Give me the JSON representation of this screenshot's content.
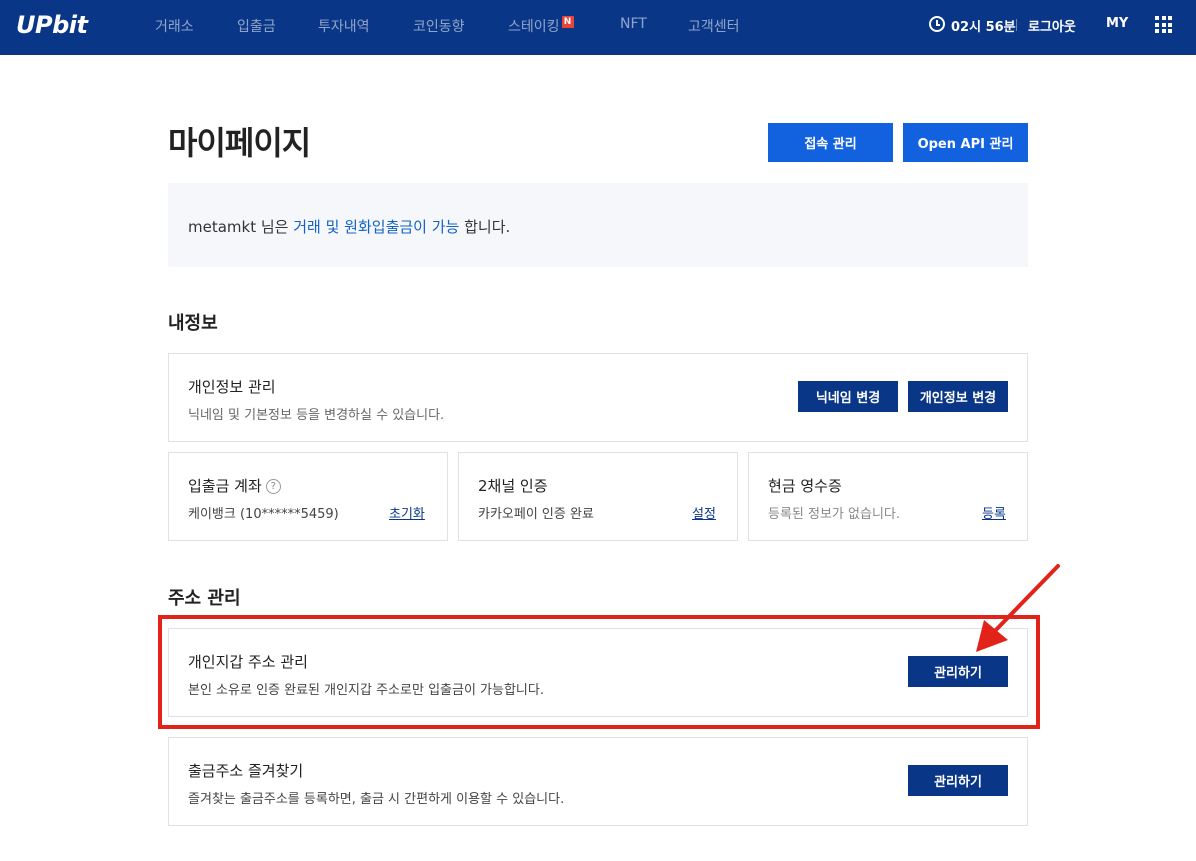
{
  "header": {
    "logo": "UPbit",
    "nav": [
      "거래소",
      "입출금",
      "투자내역",
      "코인동향",
      "스테이킹",
      "NFT",
      "고객센터"
    ],
    "new_badge": "N",
    "time": "02시 56분",
    "logout": "로그아웃",
    "my": "MY"
  },
  "page": {
    "title": "마이페이지",
    "access_btn": "접속 관리",
    "api_btn": "Open API 관리"
  },
  "notice": {
    "user": "metamkt 님은 ",
    "highlight": "거래 및 원화입출금이 가능",
    "suffix": " 합니다."
  },
  "my_info": {
    "title": "내정보",
    "personal": {
      "title": "개인정보 관리",
      "sub": "닉네임 및 기본정보 등을 변경하실 수 있습니다.",
      "nickname_btn": "닉네임 변경",
      "info_btn": "개인정보 변경"
    },
    "account": {
      "title": "입출금 계좌",
      "help": "?",
      "value": "케이뱅크 (10******5459)",
      "link": "초기화"
    },
    "two_channel": {
      "title": "2채널 인증",
      "value": "카카오페이 인증 완료",
      "link": "설정"
    },
    "receipt": {
      "title": "현금 영수증",
      "value": "등록된 정보가 없습니다.",
      "link": "등록"
    }
  },
  "address": {
    "title": "주소 관리",
    "wallet": {
      "title": "개인지갑 주소 관리",
      "sub": "본인 소유로 인증 완료된 개인지갑 주소로만 입출금이 가능합니다.",
      "btn": "관리하기"
    },
    "favorites": {
      "title": "출금주소 즐겨찾기",
      "sub": "즐겨찾는 출금주소를 등록하면, 출금 시 간편하게 이용할 수 있습니다.",
      "btn": "관리하기"
    }
  },
  "colors": {
    "header_bg": "#093687",
    "primary_blue": "#1262e0",
    "navy": "#093687",
    "highlight_box": "#e2231a"
  }
}
